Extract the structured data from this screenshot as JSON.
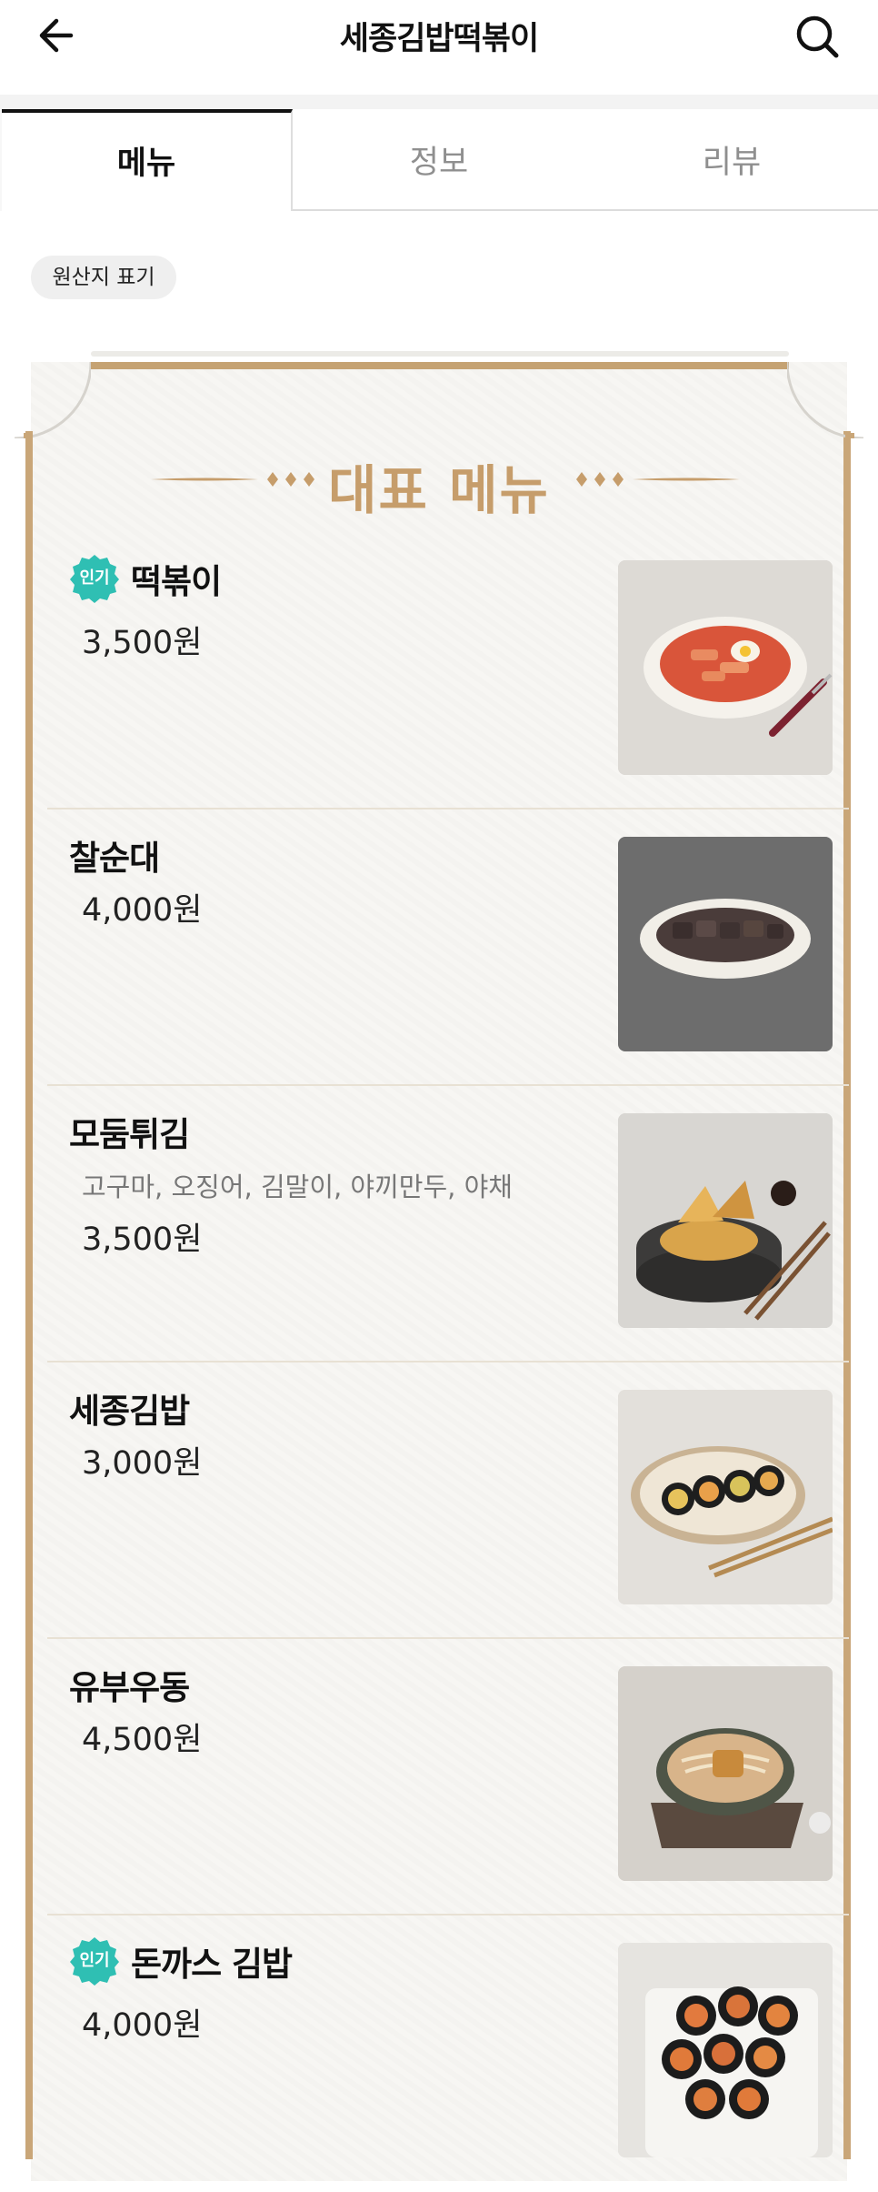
{
  "header": {
    "title": "세종김밥떡볶이",
    "back_icon": "arrow-left-icon",
    "search_icon": "search-icon"
  },
  "tabs": [
    {
      "label": "메뉴",
      "active": true
    },
    {
      "label": "정보",
      "active": false
    },
    {
      "label": "리뷰",
      "active": false
    }
  ],
  "origin_chip": {
    "label": "원산지 표기"
  },
  "board": {
    "heading": "대표 메뉴",
    "accent_color": "#c69d6b",
    "items": [
      {
        "name": "떡볶이",
        "badge": "인기",
        "desc": "",
        "price": "3,500원",
        "image": "tteokbokki"
      },
      {
        "name": "찰순대",
        "badge": "",
        "desc": "",
        "price": "4,000원",
        "image": "sundae"
      },
      {
        "name": "모둠튀김",
        "badge": "",
        "desc": "고구마, 오징어, 김말이, 야끼만두, 야채",
        "price": "3,500원",
        "image": "fried"
      },
      {
        "name": "세종김밥",
        "badge": "",
        "desc": "",
        "price": "3,000원",
        "image": "gimbap"
      },
      {
        "name": "유부우동",
        "badge": "",
        "desc": "",
        "price": "4,500원",
        "image": "udon"
      },
      {
        "name": "돈까스 김밥",
        "badge": "인기",
        "desc": "",
        "price": "4,000원",
        "image": "katsu-gimbap"
      }
    ]
  },
  "colors": {
    "badge": "#2fbfb3",
    "frame": "#c9a678",
    "board_bg": "#f7f6f3"
  }
}
